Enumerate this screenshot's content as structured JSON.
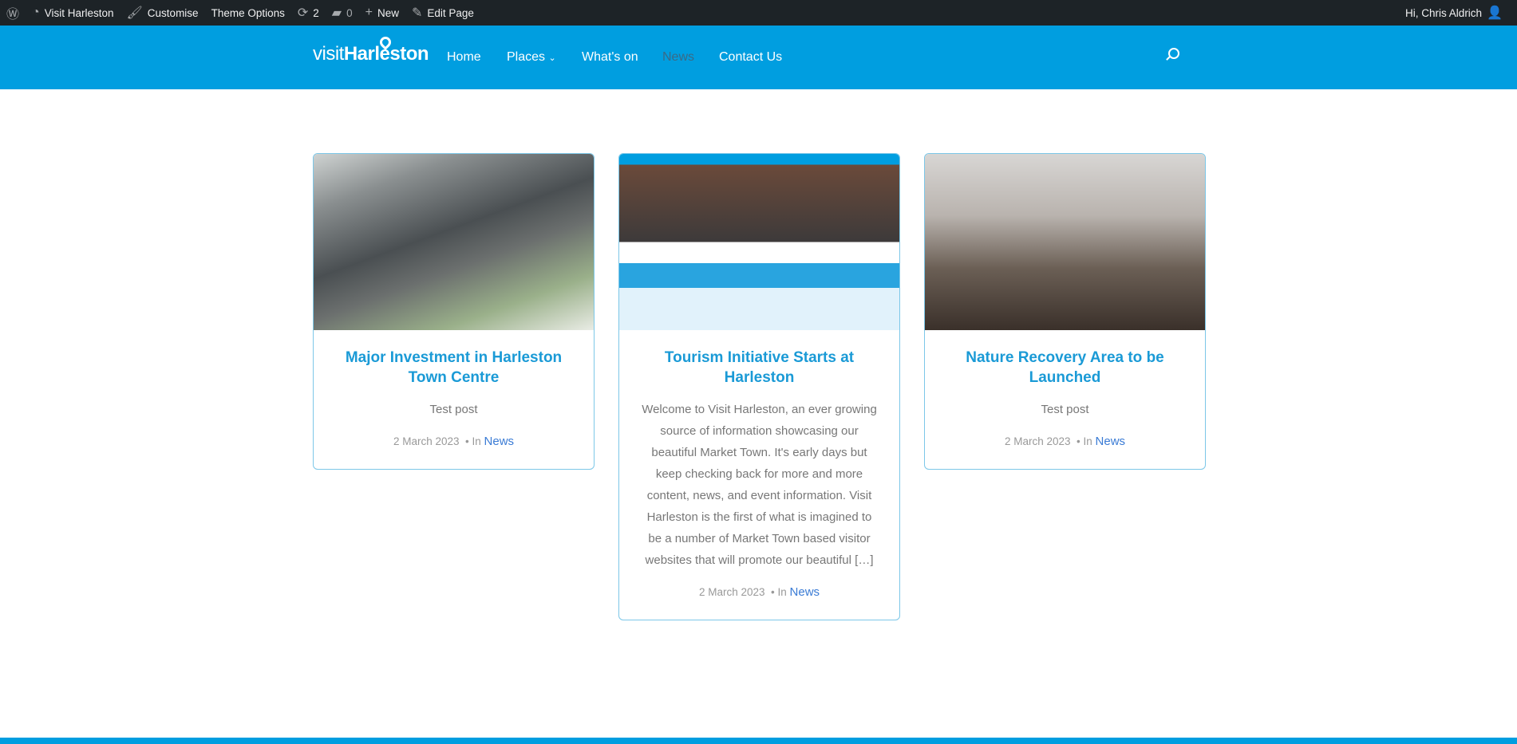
{
  "admin_bar": {
    "site": "Visit Harleston",
    "customise": "Customise",
    "theme_options": "Theme Options",
    "updates": "2",
    "comments": "0",
    "new": "New",
    "edit_page": "Edit Page",
    "greeting": "Hi, Chris Aldrich"
  },
  "header": {
    "logo_visit": "visit",
    "logo_name": "Harleston",
    "nav": [
      {
        "label": "Home"
      },
      {
        "label": "Places"
      },
      {
        "label": "What's on"
      },
      {
        "label": "News"
      },
      {
        "label": "Contact Us"
      }
    ]
  },
  "posts": [
    {
      "title": "Major Investment in Harleston Town Centre",
      "excerpt": "Test post",
      "date": "2 March 2023",
      "in": "In",
      "category": "News"
    },
    {
      "title": "Tourism Initiative Starts at Harleston",
      "excerpt": "Welcome to Visit Harleston, an ever growing source of information showcasing our beautiful Market Town. It's early days but keep checking back for more and more content, news, and event information. Visit Harleston is the first of what is imagined to be a number of Market Town based visitor websites that will promote our beautiful […]",
      "date": "2 March 2023",
      "in": "In",
      "category": "News"
    },
    {
      "title": "Nature Recovery Area to be Launched",
      "excerpt": "Test post",
      "date": "2 March 2023",
      "in": "In",
      "category": "News"
    }
  ],
  "colors": {
    "brand": "#009ee0",
    "admin_bar": "#1d2327",
    "title": "#1a9ad6"
  }
}
